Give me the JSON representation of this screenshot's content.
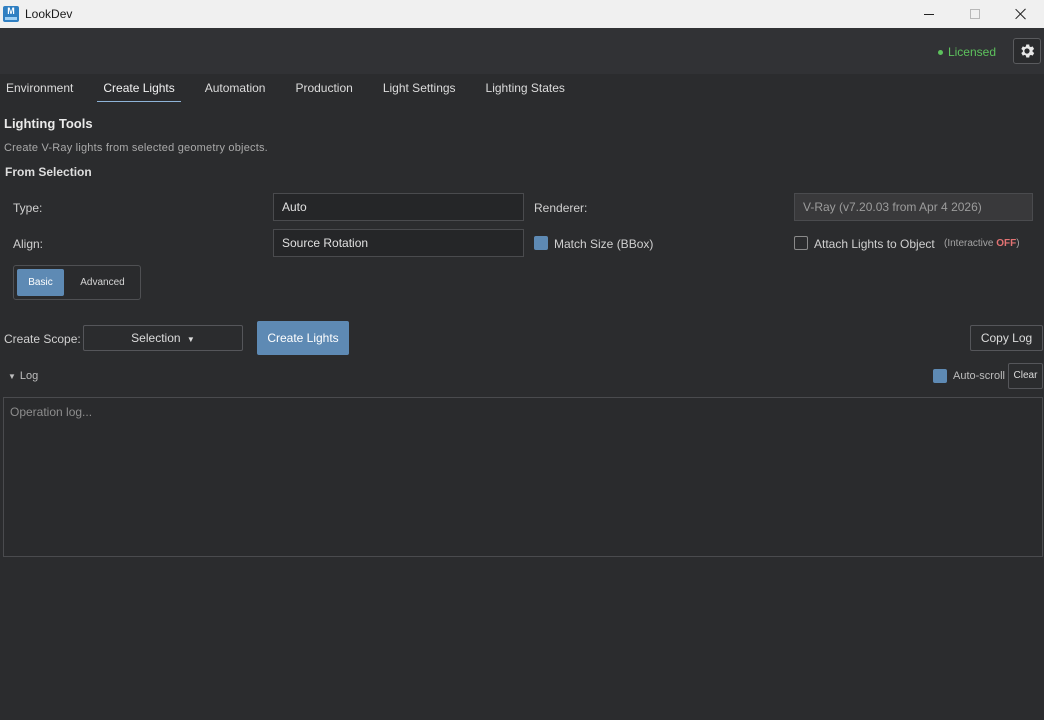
{
  "window": {
    "title": "LookDev",
    "app_icon_letter": "M"
  },
  "header": {
    "license_status": "Licensed",
    "license_color": "#5dc15d"
  },
  "tabs": [
    {
      "label": "Environment",
      "active": false
    },
    {
      "label": "Create Lights",
      "active": true
    },
    {
      "label": "Automation",
      "active": false
    },
    {
      "label": "Production",
      "active": false
    },
    {
      "label": "Light Settings",
      "active": false
    },
    {
      "label": "Lighting States",
      "active": false
    }
  ],
  "panel": {
    "title": "Lighting Tools",
    "description": "Create V-Ray lights from selected geometry objects.",
    "group_title": "From Selection"
  },
  "form": {
    "type_label": "Type:",
    "type_value": "Auto",
    "renderer_label": "Renderer:",
    "renderer_value": "V-Ray (v7.20.03 from Apr  4 2026)",
    "align_label": "Align:",
    "align_value": "Source Rotation",
    "match_size_label": "Match Size (BBox)",
    "match_size_checked": true,
    "attach_label": "Attach Lights to Object",
    "attach_checked": false,
    "interactive_prefix": "(Interactive ",
    "interactive_state": "OFF",
    "interactive_suffix": ")"
  },
  "mode": {
    "basic_label": "Basic",
    "advanced_label": "Advanced",
    "active": "Basic"
  },
  "actions": {
    "scope_label": "Create Scope:",
    "scope_value": "Selection",
    "create_label": "Create Lights",
    "copy_log_label": "Copy Log"
  },
  "log": {
    "header": "Log",
    "autoscroll_label": "Auto-scroll",
    "autoscroll_checked": true,
    "clear_label": "Clear",
    "placeholder": "Operation log..."
  },
  "colors": {
    "accent": "#5e8ab4",
    "background": "#2b2c2e",
    "off_state": "#e37373"
  }
}
